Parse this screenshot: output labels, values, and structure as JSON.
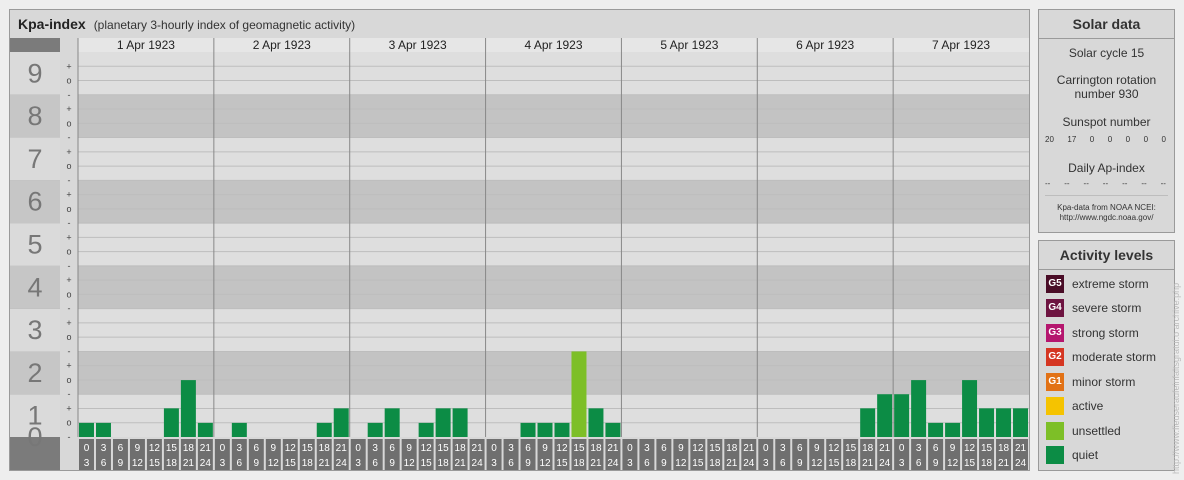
{
  "header": {
    "title": "Kpa-index",
    "subtitle": "(planetary 3-hourly index of geomagnetic activity)"
  },
  "chart_data": {
    "type": "bar",
    "title": "Kpa-index",
    "subtitle": "(planetary 3-hourly index of geomagnetic activity)",
    "ylim": [
      0,
      9
    ],
    "y_major_ticks": [
      "0",
      "1",
      "2",
      "3",
      "4",
      "5",
      "6",
      "7",
      "8",
      "9"
    ],
    "y_minor_ticks": [
      "-",
      "o",
      "+"
    ],
    "days": [
      "1 Apr 1923",
      "2 Apr 1923",
      "3 Apr 1923",
      "4 Apr 1923",
      "5 Apr 1923",
      "6 Apr 1923",
      "7 Apr 1923"
    ],
    "interval_labels": [
      [
        "0",
        "3"
      ],
      [
        "3",
        "6"
      ],
      [
        "6",
        "9"
      ],
      [
        "9",
        "12"
      ],
      [
        "12",
        "15"
      ],
      [
        "15",
        "18"
      ],
      [
        "18",
        "21"
      ],
      [
        "21",
        "24"
      ]
    ],
    "series": [
      {
        "values": [
          0.33,
          0.33,
          0,
          0,
          0,
          0.67,
          1.33,
          0.33,
          0,
          0.33,
          0,
          0,
          0,
          0,
          0.33,
          0.67,
          0,
          0.33,
          0.67,
          0,
          0.33,
          0.67,
          0.67,
          0,
          0,
          0,
          0.33,
          0.33,
          0.33,
          2.0,
          0.67,
          0.33,
          0,
          0,
          0,
          0,
          0,
          0,
          0,
          0,
          0,
          0,
          0,
          0,
          0,
          0,
          0.67,
          1.0,
          1.0,
          1.33,
          0.33,
          0.33,
          1.33,
          0.67,
          0.67,
          0.67
        ]
      }
    ],
    "grid": true
  },
  "solar": {
    "title": "Solar data",
    "cycle": "Solar cycle 15",
    "carrington": "Carrington rotation number 930",
    "sunspot_title": "Sunspot number",
    "sunspot_values": [
      "20",
      "17",
      "0",
      "0",
      "0",
      "0",
      "0"
    ],
    "ap_title": "Daily Ap-index",
    "ap_values": [
      "--",
      "--",
      "--",
      "--",
      "--",
      "--",
      "--"
    ],
    "source_line1": "Kpa-data from NOAA NCEI:",
    "source_line2": "http://www.ngdc.noaa.gov/"
  },
  "levels": {
    "title": "Activity levels",
    "items": [
      {
        "badge": "G5",
        "label": "extreme storm",
        "color": "#4a0d27"
      },
      {
        "badge": "G4",
        "label": "severe storm",
        "color": "#6e1441"
      },
      {
        "badge": "G3",
        "label": "strong storm",
        "color": "#b5166e"
      },
      {
        "badge": "G2",
        "label": "moderate storm",
        "color": "#d53622"
      },
      {
        "badge": "G1",
        "label": "minor storm",
        "color": "#e27216"
      },
      {
        "badge": "",
        "label": "active",
        "color": "#f5c300"
      },
      {
        "badge": "",
        "label": "unsettled",
        "color": "#7dbf27"
      },
      {
        "badge": "",
        "label": "quiet",
        "color": "#0c8c45"
      }
    ]
  },
  "credit": "http://www.fieuseraufeinfaltsgratui.o archive.php",
  "colors": {
    "quiet": "#0c8c45",
    "unsettled": "#7dbf27",
    "band_dark": "#c3c3c3",
    "band_light": "#dedede",
    "ylabel_bg": "#7b7b7b"
  }
}
